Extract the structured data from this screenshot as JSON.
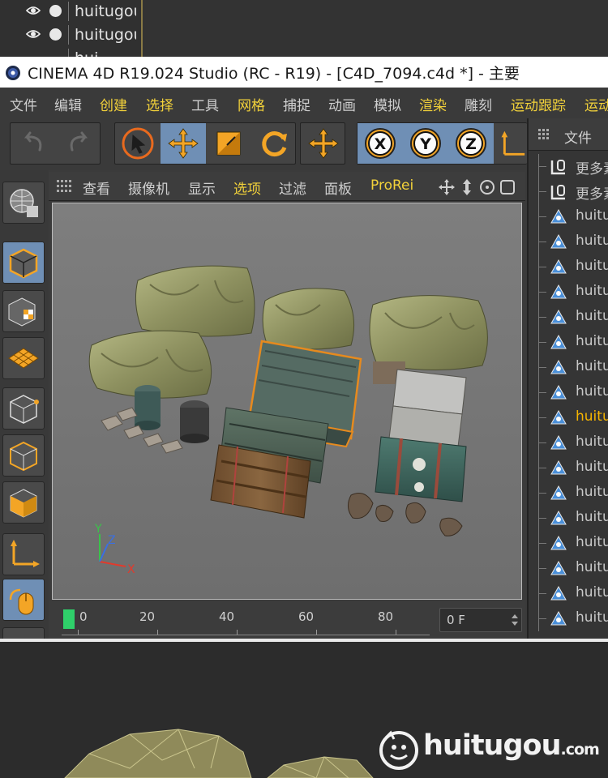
{
  "top_strip": {
    "rows": [
      {
        "label": "huitugou"
      },
      {
        "label": "huitugou"
      },
      {
        "label": "hui"
      }
    ]
  },
  "window": {
    "title": "CINEMA 4D R19.024 Studio (RC - R19) - [C4D_7094.c4d *] - 主要"
  },
  "menu": {
    "items": [
      "文件",
      "编辑",
      "创建",
      "选择",
      "工具",
      "网格",
      "捕捉",
      "动画",
      "模拟",
      "渲染",
      "雕刻",
      "运动跟踪",
      "运动"
    ]
  },
  "toolbar": {
    "icons": [
      "undo-icon",
      "redo-icon",
      "select-icon",
      "move-icon",
      "scale-icon",
      "rotate-icon",
      "move-alt-icon",
      "x-axis-icon",
      "y-axis-icon",
      "z-axis-icon",
      "coordinate-system-icon"
    ],
    "axis_labels": [
      "X",
      "Y",
      "Z"
    ]
  },
  "viewport_menu": {
    "items": [
      "查看",
      "摄像机",
      "显示",
      "选项",
      "过滤",
      "面板",
      "ProRei"
    ]
  },
  "viewport": {
    "axis_labels": {
      "x": "X",
      "y": "Y",
      "z": "Z"
    },
    "colors": {
      "x": "#e23a2c",
      "y": "#3ac24a",
      "z": "#3a6fe2",
      "background": "#7a7a7a"
    }
  },
  "timeline": {
    "marks": [
      "0",
      "20",
      "40",
      "60",
      "80"
    ],
    "current_frame": "0 F"
  },
  "object_manager": {
    "header": "文件",
    "rows": [
      {
        "label": "更多素",
        "type": "null"
      },
      {
        "label": "更多素",
        "type": "null"
      },
      {
        "label": "huitu",
        "type": "mesh"
      },
      {
        "label": "huitu",
        "type": "mesh"
      },
      {
        "label": "huitu",
        "type": "mesh"
      },
      {
        "label": "huitu",
        "type": "mesh"
      },
      {
        "label": "huitu",
        "type": "mesh"
      },
      {
        "label": "huitu",
        "type": "mesh"
      },
      {
        "label": "huitu",
        "type": "mesh"
      },
      {
        "label": "huitu",
        "type": "mesh"
      },
      {
        "label": "huitu",
        "type": "mesh",
        "selected": true
      },
      {
        "label": "huitu",
        "type": "mesh"
      },
      {
        "label": "huitu",
        "type": "mesh"
      },
      {
        "label": "huitu",
        "type": "mesh"
      },
      {
        "label": "huitu",
        "type": "mesh"
      },
      {
        "label": "huitu",
        "type": "mesh"
      },
      {
        "label": "huitu",
        "type": "mesh"
      },
      {
        "label": "huitu",
        "type": "mesh"
      },
      {
        "label": "huitu",
        "type": "mesh"
      }
    ]
  },
  "watermark": {
    "text": "huitugou",
    "suffix": ".com"
  },
  "colors": {
    "accent_blue": "#6f8fb5",
    "selection_yellow": "#f5b400",
    "tool_orange": "#f3a526",
    "playhead_green": "#2fd06a"
  }
}
